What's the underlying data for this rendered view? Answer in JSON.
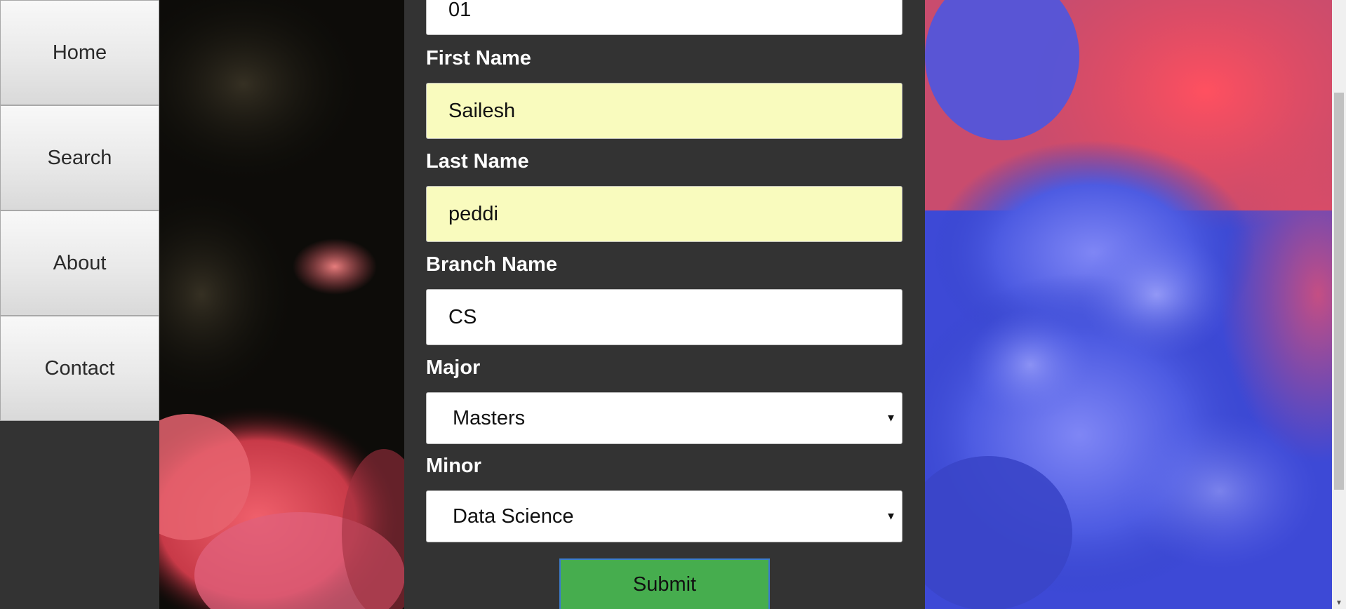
{
  "nav": {
    "items": [
      {
        "label": "Home"
      },
      {
        "label": "Search"
      },
      {
        "label": "About"
      },
      {
        "label": "Contact"
      }
    ]
  },
  "form": {
    "id_value": "01",
    "first_name": {
      "label": "First Name",
      "value": "Sailesh"
    },
    "last_name": {
      "label": "Last Name",
      "value": "peddi"
    },
    "branch_name": {
      "label": "Branch Name",
      "value": "CS"
    },
    "major": {
      "label": "Major",
      "selected": "Masters"
    },
    "minor": {
      "label": "Minor",
      "selected": "Data Science"
    },
    "submit_label": "Submit"
  },
  "icons": {
    "select_caret": "caret-down-icon",
    "scroll_arrow": "scroll-down-arrow-icon"
  },
  "colors": {
    "page_bg": "#333333",
    "autofill_bg": "#f9fbbe",
    "submit_bg": "#46ad4e"
  }
}
